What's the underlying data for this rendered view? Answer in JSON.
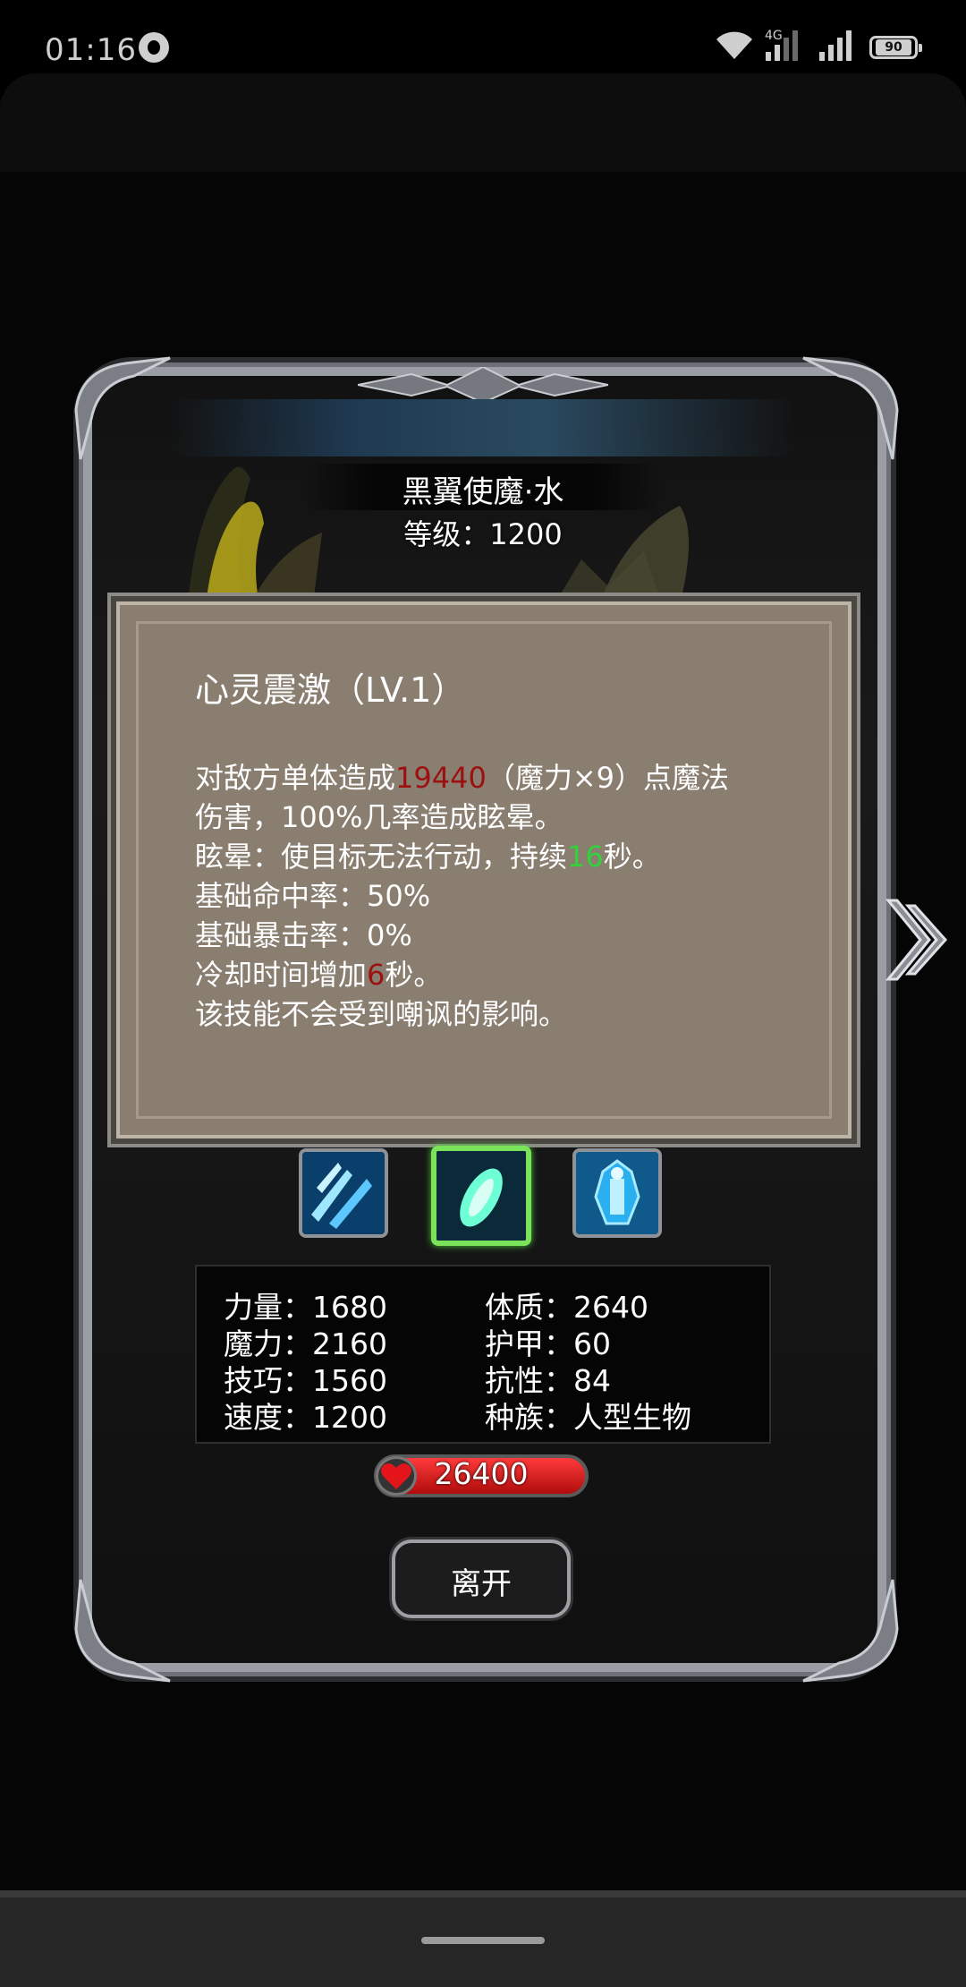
{
  "status_bar": {
    "time": "01:16",
    "network": "4G",
    "battery": "90",
    "icons": [
      "notification-icon",
      "wifi-icon",
      "signal-icon",
      "signal-icon",
      "battery-icon"
    ]
  },
  "monster": {
    "name": "黑翼使魔·水",
    "level_line": "等级：1200"
  },
  "skill": {
    "title": "心灵震激（LV.1）",
    "desc": {
      "l1_a": "对敌方单体造成",
      "l1_val": "19440",
      "l1_b": "（魔力×9）点魔法",
      "l2": "伤害，100%几率造成眩晕。",
      "l3_a": "眩晕：使目标无法行动，持续",
      "l3_val": "16",
      "l3_b": "秒。",
      "l4": "基础命中率：50%",
      "l5": "基础暴击率：0%",
      "l6_a": "冷却时间增加",
      "l6_val": "6",
      "l6_b": "秒。",
      "l7": "该技能不会受到嘲讽的影响。"
    },
    "colors": {
      "damage": "#9d1010",
      "duration": "#33d23a",
      "cooldown": "#9d1010"
    },
    "icons": [
      "ice-shards-icon",
      "crystal-shard-icon",
      "ice-armor-icon"
    ],
    "selected_index": 1
  },
  "stats": {
    "strength": "力量：1680",
    "constitution": "体质：2640",
    "magic": "魔力：2160",
    "armor": "护甲：60",
    "skill": "技巧：1560",
    "resistance": "抗性：84",
    "speed": "速度：1200",
    "race": "种族：人型生物"
  },
  "hp": "26400",
  "leave_button": "离开"
}
